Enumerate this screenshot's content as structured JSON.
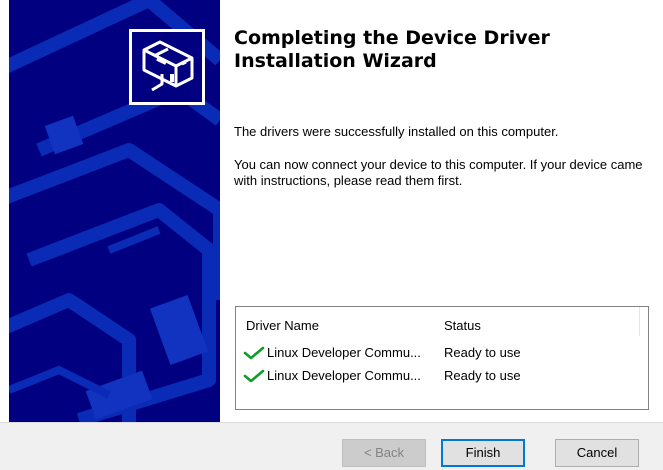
{
  "wizard": {
    "title": "Completing the Device Driver Installation Wizard",
    "message_1": "The drivers were successfully installed on this computer.",
    "message_2": "You can now connect your device to this computer. If your device came with instructions, please read them first."
  },
  "driver_list": {
    "columns": [
      "Driver Name",
      "Status"
    ],
    "rows": [
      {
        "name": "Linux Developer Commu...",
        "status": "Ready to use",
        "icon": "checkmark-icon"
      },
      {
        "name": "Linux Developer Commu...",
        "status": "Ready to use",
        "icon": "checkmark-icon"
      }
    ]
  },
  "buttons": {
    "back": "< Back",
    "finish": "Finish",
    "cancel": "Cancel"
  },
  "colors": {
    "side_panel": "#000080",
    "check": "#0f9d2a",
    "focus_border": "#0078d7"
  }
}
